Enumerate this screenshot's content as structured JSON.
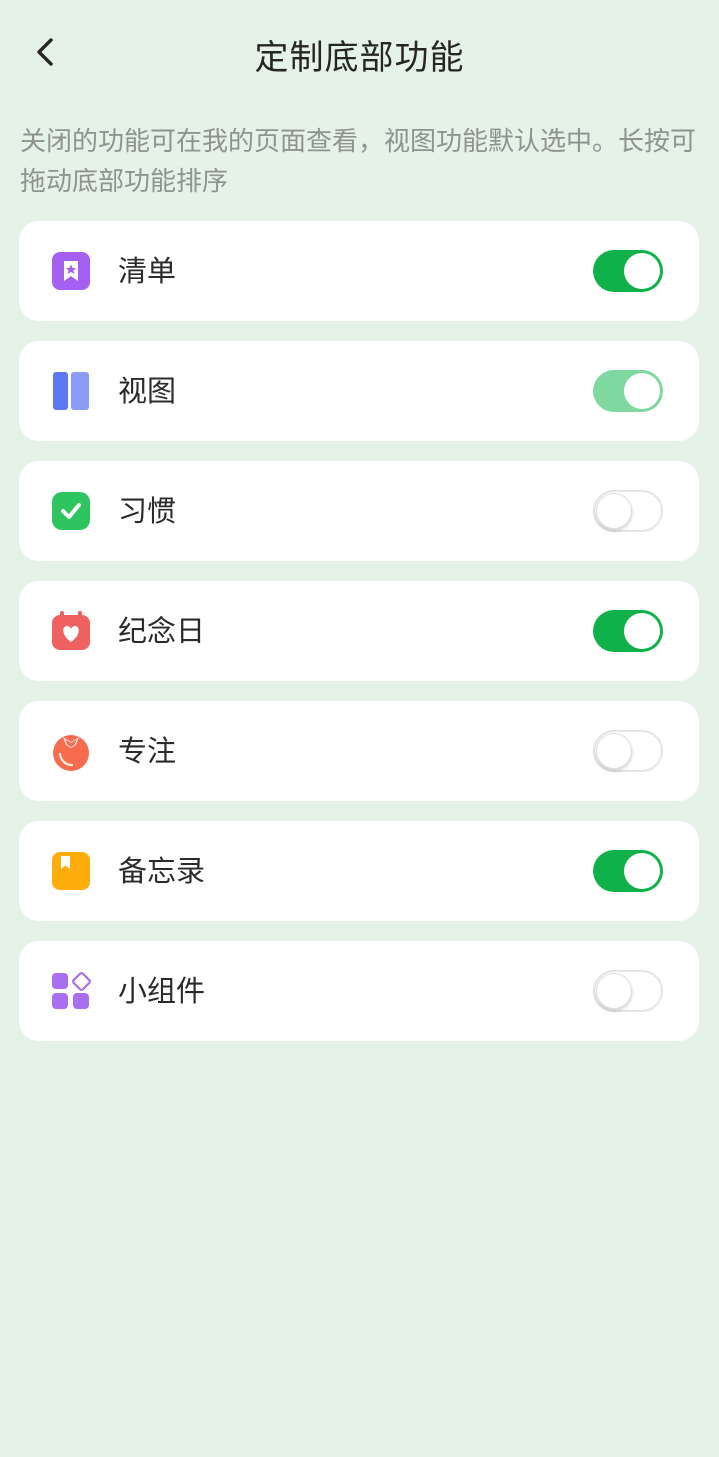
{
  "header": {
    "title": "定制底部功能"
  },
  "description": "关闭的功能可在我的页面查看，视图功能默认选中。长按可拖动底部功能排序",
  "items": [
    {
      "label": "清单",
      "icon": "list-bookmark-icon",
      "icon_color": "#a560f2",
      "enabled": true
    },
    {
      "label": "视图",
      "icon": "view-columns-icon",
      "icon_color": "#6b82f5",
      "enabled": true,
      "locked": true
    },
    {
      "label": "习惯",
      "icon": "habit-check-icon",
      "icon_color": "#2ec45f",
      "enabled": false
    },
    {
      "label": "纪念日",
      "icon": "anniversary-calendar-icon",
      "icon_color": "#f06262",
      "enabled": true
    },
    {
      "label": "专注",
      "icon": "focus-tomato-icon",
      "icon_color": "#f76b4f",
      "enabled": false
    },
    {
      "label": "备忘录",
      "icon": "memo-bookmark-icon",
      "icon_color": "#ffad0a",
      "enabled": true
    },
    {
      "label": "小组件",
      "icon": "widgets-grid-icon",
      "icon_color": "#a870f0",
      "enabled": false
    }
  ],
  "colors": {
    "background": "#e5f2e8",
    "toggle_on": "#0fb24a",
    "toggle_on_locked": "#7fd8a0"
  }
}
